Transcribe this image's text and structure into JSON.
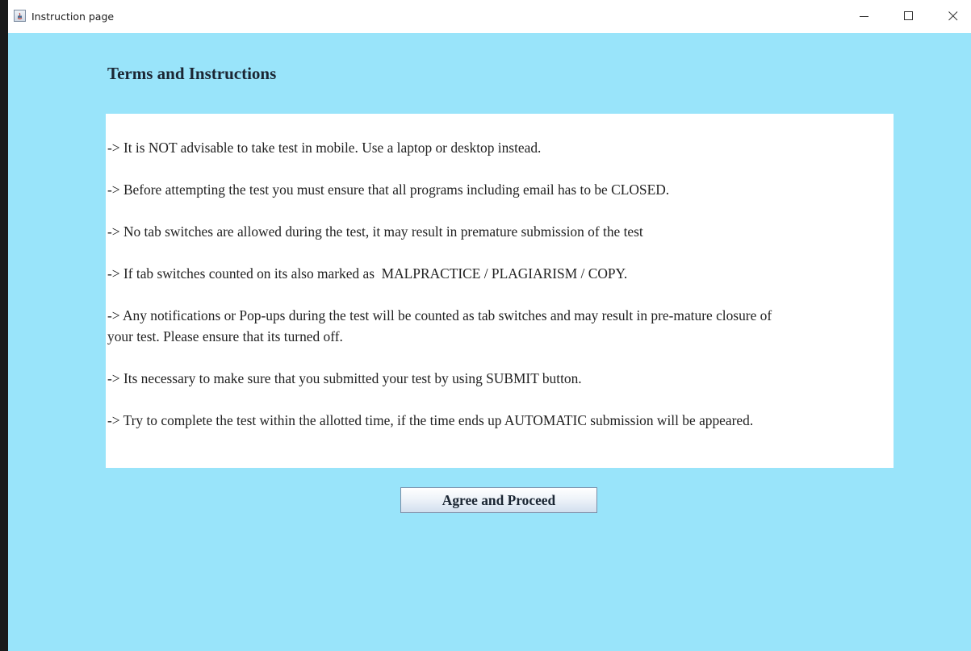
{
  "window": {
    "title": "Instruction page",
    "app_icon": "java-app-icon",
    "controls": {
      "minimize_icon": "minimize-icon",
      "maximize_icon": "maximize-icon",
      "close_icon": "close-icon"
    }
  },
  "colors": {
    "background": "#99e4fa",
    "panel": "#ffffff",
    "text": "#222222"
  },
  "page": {
    "title": "Terms and Instructions",
    "instructions": [
      "-> It is NOT advisable to take test in mobile. Use a laptop or desktop instead.",
      "-> Before attempting the test you must ensure that all programs including email has to be CLOSED.",
      "-> No tab switches are allowed during the test, it may result in premature submission of the test",
      "-> If tab switches counted on its also marked as  MALPRACTICE / PLAGIARISM / COPY.",
      "-> Any notifications or Pop-ups during the test will be counted as tab switches and may result in pre-mature closure of your test. Please ensure that its turned off.",
      "-> Its necessary to make sure that you submitted your test by using SUBMIT button.",
      "-> Try to complete the test within the allotted time, if the time ends up AUTOMATIC submission will be appeared."
    ],
    "agree_button": "Agree and Proceed"
  }
}
